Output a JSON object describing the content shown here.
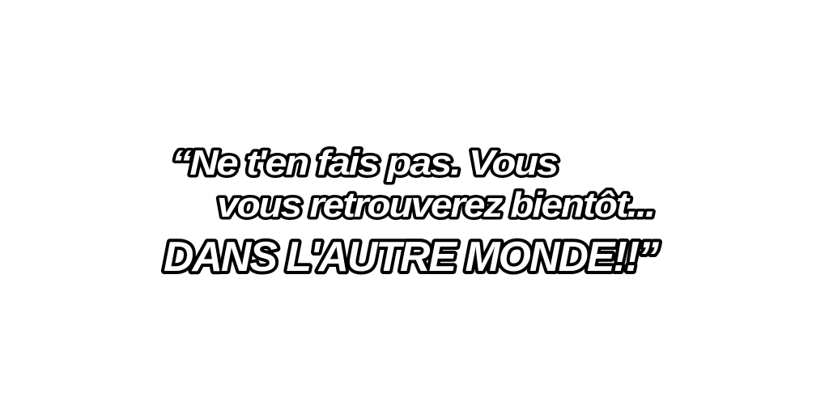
{
  "caption": {
    "line1": "“Ne t'en fais pas. Vous",
    "line2": "vous retrouverez bientôt...",
    "line3": "DANS L'AUTRE MONDE!!”"
  },
  "colors": {
    "background": "#ffffff",
    "text_fill": "#ffffff",
    "text_outline": "#000000"
  }
}
